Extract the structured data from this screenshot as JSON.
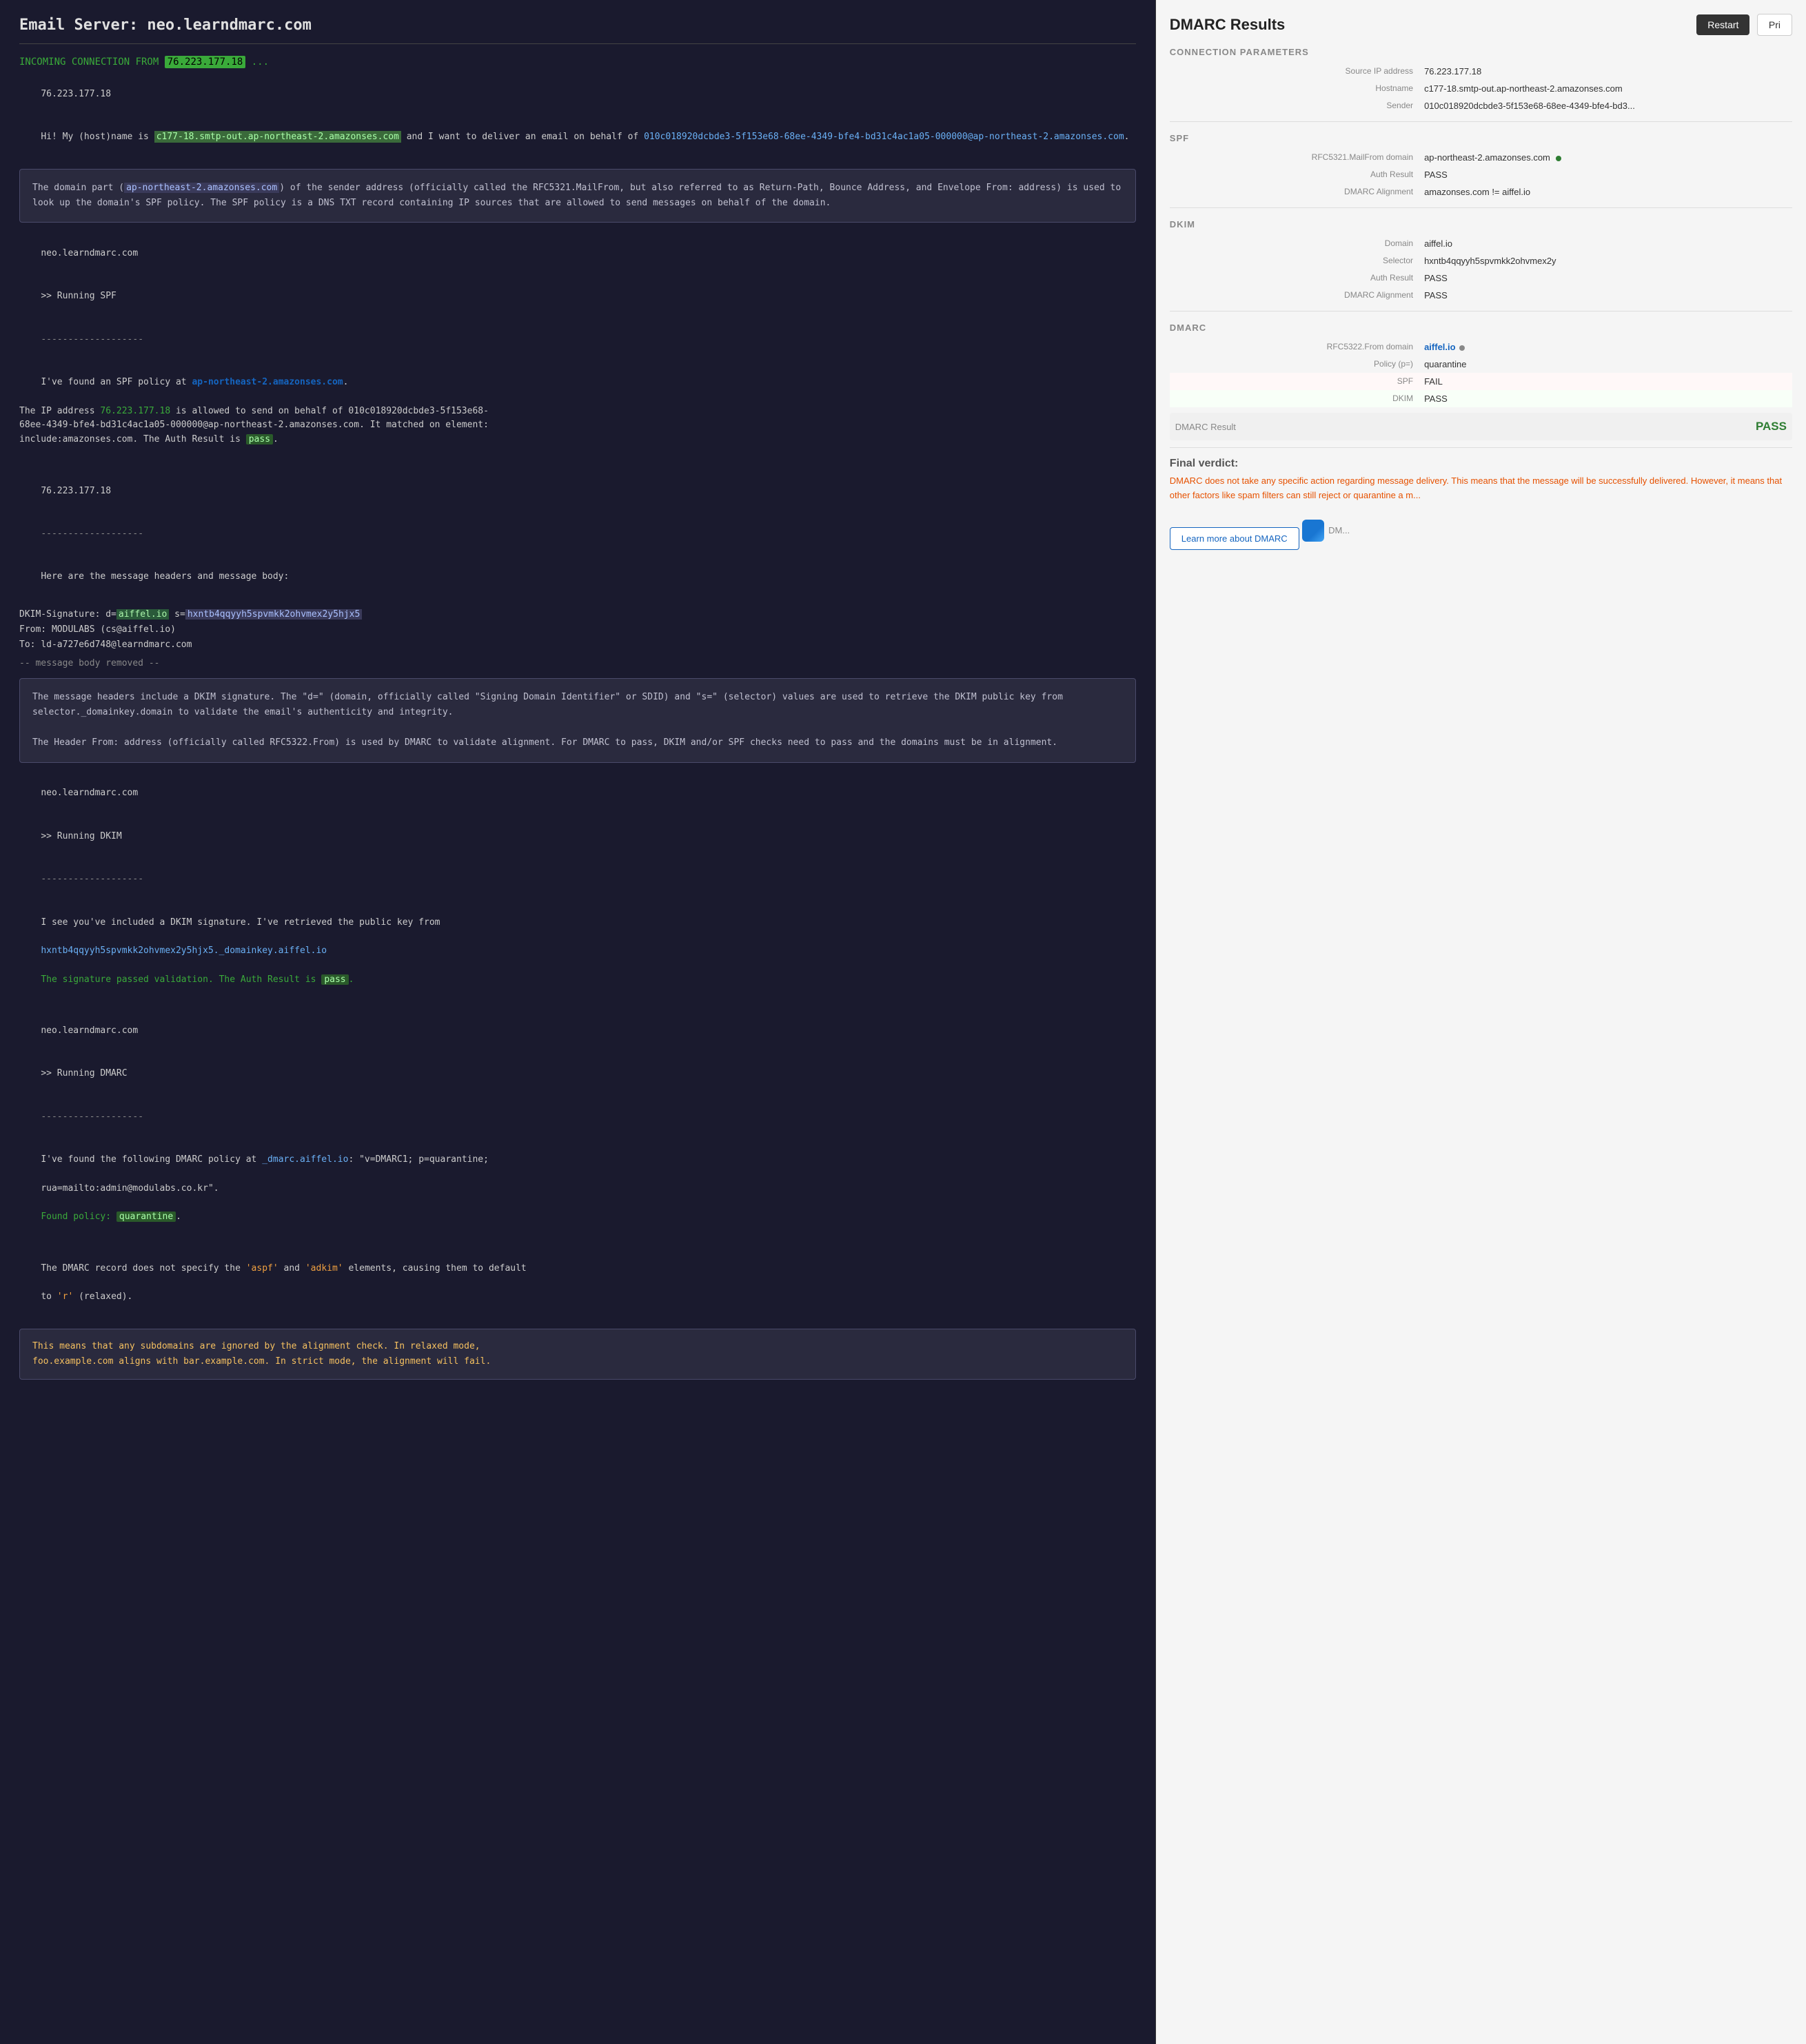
{
  "left": {
    "title": "Email Server: neo.learndmarc.com",
    "incoming_label": "INCOMING CONNECTION FROM",
    "incoming_ip": "76.223.177.18",
    "incoming_dots": "...",
    "ip_line": "76.223.177.18",
    "greeting": "Hi! My (host)name is",
    "hostname": "c177-18.smtp-out.ap-northeast-2.amazonses.com",
    "greeting2": " and I want to deliver an email on behalf of ",
    "sender_email": "010c018920dcbde3-5f153e68-68ee-4349-bfe4-bd31c4ac1a05-000000@ap-northeast-2.amazonses.com",
    "info_box1": "The domain part (ap-northeast-2.amazonses.com) of the sender address (officially called the RFC5321.MailFrom, but also referred to as Return-Path, Bounce Address, and Envelope From: address) is used to look up the domain's SPF policy. The SPF policy is a DNS TXT record containing IP sources that are allowed to send messages on behalf of the domain.",
    "info_box1_highlight": "ap-northeast-2.amazonses.com",
    "server1": "neo.learndmarc.com",
    "running_spf": ">> Running SPF",
    "dashed": "-------------------",
    "spf_found": "I've found an SPF policy at",
    "spf_domain": "ap-northeast-2.amazonses.com",
    "spf_allowed": ". The IP address",
    "spf_ip": "76.223.177.18",
    "spf_allowed2": " is allowed to send on behalf of",
    "spf_email2": " 010c018920dcbde3-5f153e68-68ee-4349-bfe4-bd31c4ac1a05-000000@ap-northeast-2.amazonses.com",
    "spf_matched": ". It matched on element: include:amazonses.com. The Auth Result is",
    "spf_pass": "pass",
    "ip_line2": "76.223.177.18",
    "dashed2": "-------------------",
    "headers_line": "Here are the message headers and message body:",
    "dkim_sig_line": "DKIM-Signature: d=aiffel.io s=hxntb4qqyyh5spvmkk2ohvmex2y5hjx5",
    "dkim_sig_d": "aiffel.io",
    "dkim_sig_s": "hxntb4qqyyh5spvmkk2ohvmex2y5hjx5",
    "from_line": "From: MODULABS (cs@aiffel.io)",
    "to_line": "To: ld-a727e6d748@learndmarc.com",
    "body_removed": "-- message body removed --",
    "info_box2_line1": "The message headers include a DKIM signature. The \"d=\" (domain, officially called",
    "info_box2_line2": "\"Signing Domain Identifier\" or SDID) and \"s=\" (selector) values are used to retrieve",
    "info_box2_line3": "the DKIM public key from selector._domainkey.domain to validate the email's",
    "info_box2_line4": "authenticity and integrity.",
    "info_box2_line5": "",
    "info_box2_line6": "The Header From: address (officially called RFC5322.From) is used by DMARC to validate",
    "info_box2_line7": "alignment. For DMARC to pass, DKIM and/or SPF checks need to pass and the domains must",
    "info_box2_line8": "be in alignment.",
    "server2": "neo.learndmarc.com",
    "running_dkim": ">> Running DKIM",
    "dashed3": "-------------------",
    "dkim_found": "I see you've included a DKIM signature. I've retrieved the public key from",
    "dkim_key_link": "hxntb4qqyyh5spvmkk2ohvmex2y5hjx5._domainkey.aiffel.io",
    "dkim_pass_line": "The signature passed validation. The Auth Result is",
    "dkim_pass": "pass",
    "server3": "neo.learndmarc.com",
    "running_dmarc": ">> Running DMARC",
    "dashed4": "-------------------",
    "dmarc_found": "I've found the following DMARC policy at _dmarc.aiffel.io: \"v=DMARC1; p=quarantine;",
    "dmarc_rua": "rua=mailto:admin@modulabs.co.kr\".",
    "dmarc_policy_found": "Found policy:",
    "dmarc_quarantine": "quarantine",
    "dmarc_no_aspf": "The DMARC record does not specify the",
    "dmarc_aspf": "'aspf'",
    "dmarc_and": "and",
    "dmarc_adkim": "'adkim'",
    "dmarc_elements": "elements, causing them to default",
    "dmarc_to_r": "to 'r' (relaxed).",
    "relaxed_box": "This means that any subdomains are ignored by the alignment check. In relaxed mode,\nfoo.example.com aligns with bar.example.com. In strict mode, the alignment will fail."
  },
  "right": {
    "title": "DMARC Results",
    "restart_btn": "Restart",
    "pri_btn": "Pri",
    "connection_params_label": "Connection parameters",
    "source_ip_label": "Source IP address",
    "source_ip_val": "76.223.177.18",
    "hostname_label": "Hostname",
    "hostname_val": "c177-18.smtp-out.ap-northeast-2.amazonses.com",
    "sender_label": "Sender",
    "sender_val": "010c018920dcbde3-5f153e68-68ee-4349-bfe4-bd3...",
    "spf_label": "SPF",
    "rfc5321_label": "RFC5321.MailFrom domain",
    "rfc5321_val": "ap-northeast-2.amazonses.com",
    "auth_result_label": "Auth Result",
    "auth_result_val": "PASS",
    "dmarc_align_label": "DMARC Alignment",
    "dmarc_align_val": "amazonses.com != aiffel.io",
    "dkim_label": "DKIM",
    "dkim_domain_label": "Domain",
    "dkim_domain_val": "aiffel.io",
    "dkim_selector_label": "Selector",
    "dkim_selector_val": "hxntb4qqyyh5spvmkk2ohvmex2y",
    "dkim_auth_label": "Auth Result",
    "dkim_auth_val": "PASS",
    "dkim_dmarc_label": "DMARC Alignment",
    "dkim_dmarc_val": "PASS",
    "dmarc_section_label": "DMARC",
    "rfc5322_label": "RFC5322.From domain",
    "rfc5322_val": "aiffel.io",
    "policy_label": "Policy (p=)",
    "policy_val": "quarantine",
    "spf_result_label": "SPF",
    "spf_result_val": "FAIL",
    "dkim_result_label": "DKIM",
    "dkim_result_val": "PASS",
    "dmarc_result_label": "DMARC Result",
    "dmarc_result_val": "PASS",
    "final_verdict_label": "Final verdict:",
    "verdict_text": "DMARC does not take any specific action regarding message delivery. This means that the message will be successfully delivered. However, it means that other factors like spam filters can still reject or quarantine a m...",
    "learn_btn": "Learn more about DMARC",
    "dmarc_logo_text": "DM..."
  }
}
